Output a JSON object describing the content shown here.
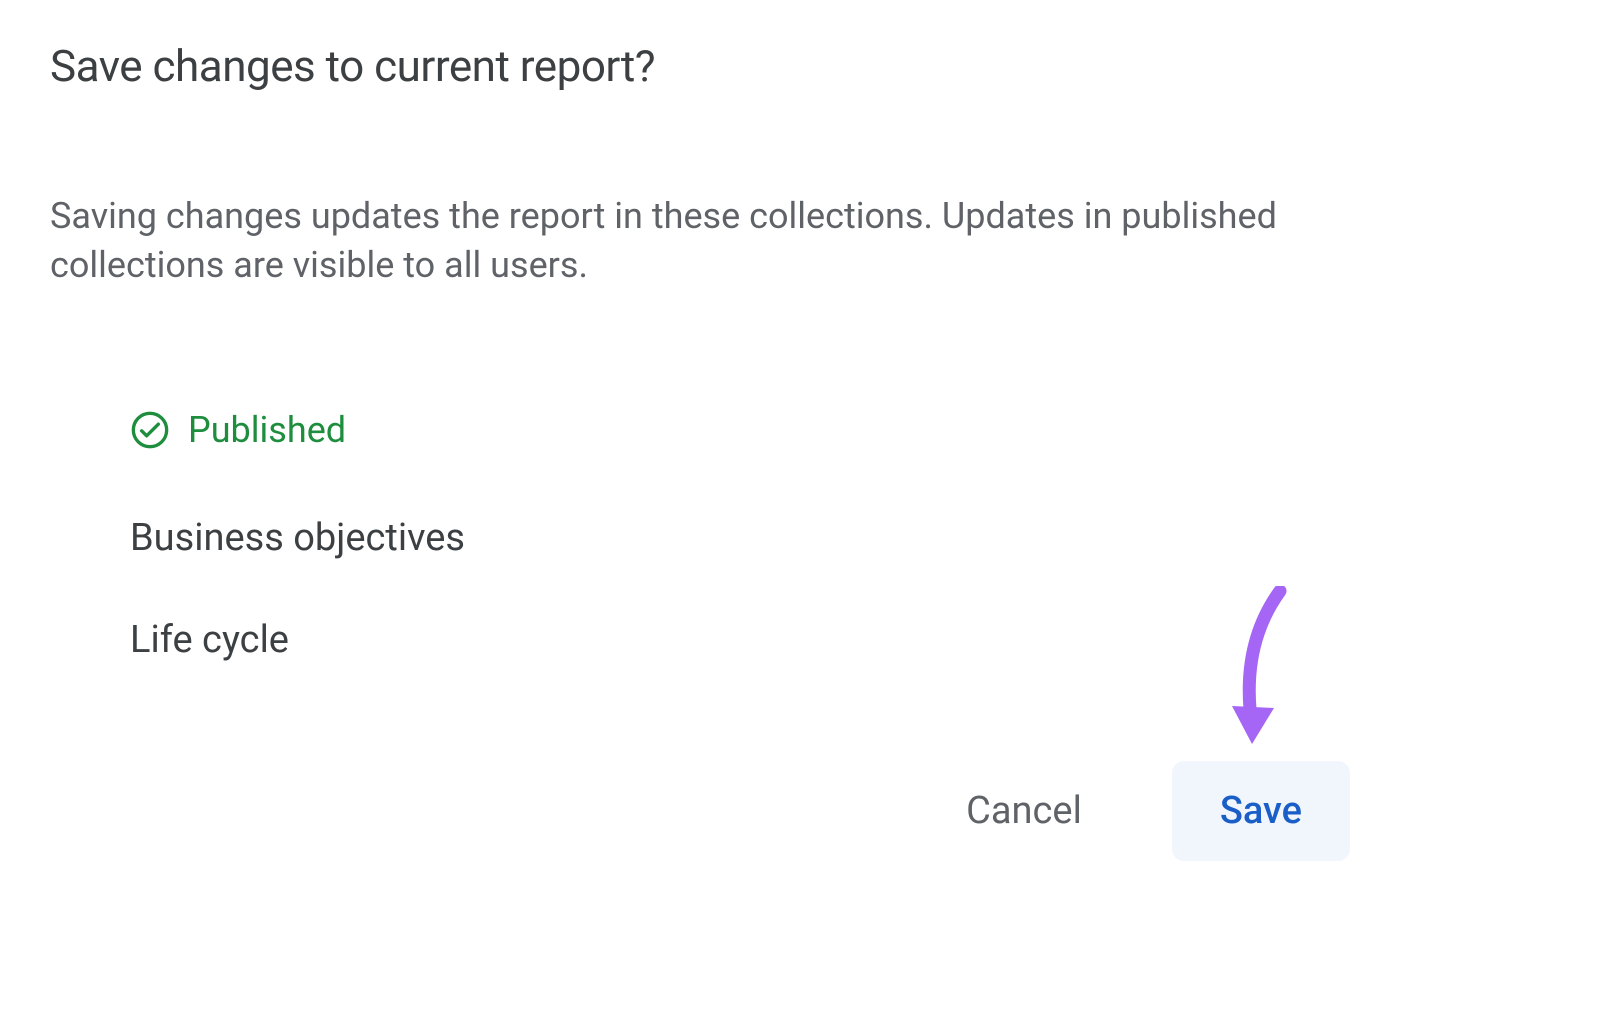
{
  "dialog": {
    "title": "Save changes to current report?",
    "description": "Saving changes updates the report in these collections. Updates in published collections are visible to all users.",
    "status": {
      "label": "Published",
      "color": "#1e8e3e"
    },
    "collections": [
      "Business objectives",
      "Life cycle"
    ],
    "actions": {
      "cancel_label": "Cancel",
      "save_label": "Save"
    }
  },
  "colors": {
    "accent_green": "#1e8e3e",
    "accent_blue": "#1a5fc7",
    "annotation_purple": "#a565f5",
    "text_primary": "#3c4043",
    "text_secondary": "#5f6368"
  }
}
